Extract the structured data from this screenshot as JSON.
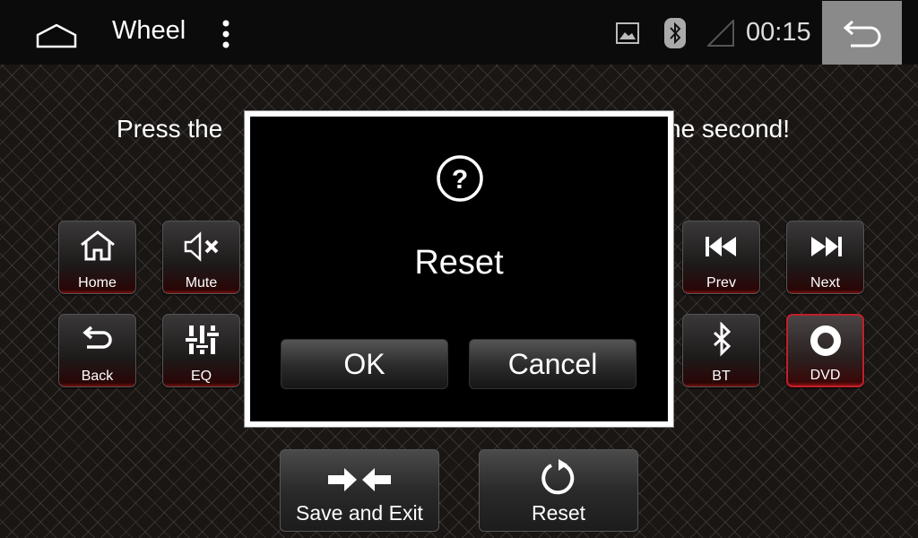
{
  "statusbar": {
    "title": "Wheel",
    "clock": "00:15",
    "icons": [
      "home-icon",
      "overflow-menu-icon",
      "gallery-icon",
      "bluetooth-icon",
      "signal-icon",
      "back-icon"
    ]
  },
  "instruction": {
    "left_fragment": "Press the",
    "right_fragment": "ne second!"
  },
  "keys": [
    {
      "label": "Home",
      "icon": "home-icon"
    },
    {
      "label": "Mute",
      "icon": "mute-icon"
    },
    {
      "label": "Prev",
      "icon": "previous-icon"
    },
    {
      "label": "Next",
      "icon": "next-icon"
    },
    {
      "label": "Back",
      "icon": "back-icon"
    },
    {
      "label": "EQ",
      "icon": "equalizer-icon"
    },
    {
      "label": "BT",
      "icon": "bluetooth-icon"
    },
    {
      "label": "DVD",
      "icon": "disc-icon",
      "selected": true
    }
  ],
  "actions": {
    "save_exit": "Save and Exit",
    "reset": "Reset"
  },
  "dialog": {
    "icon": "question-icon",
    "message": "Reset",
    "ok": "OK",
    "cancel": "Cancel"
  },
  "colors": {
    "selected_border": "#c0202a",
    "back_button_bg": "#8a8a8a"
  }
}
